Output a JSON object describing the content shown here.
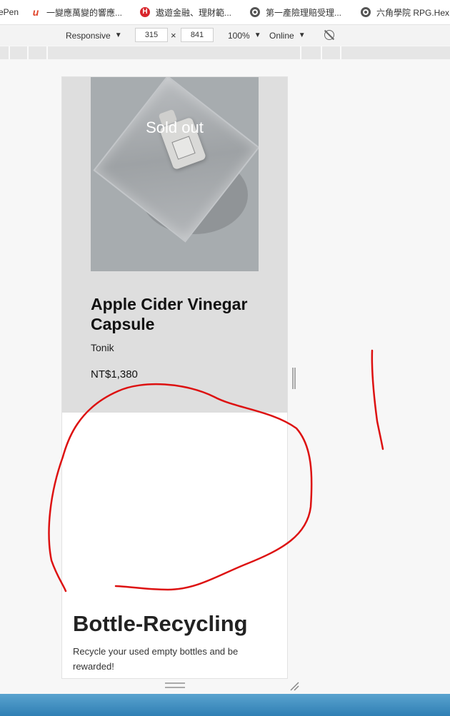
{
  "bookmarks": [
    {
      "label": "ePen",
      "icon": "codepen-icon"
    },
    {
      "label": "一變應萬變的響應...",
      "icon": "u-logo-icon"
    },
    {
      "label": "遨遊金融、理財範...",
      "icon": "h-logo-icon"
    },
    {
      "label": "第一產險理賠受理...",
      "icon": "globe-icon"
    },
    {
      "label": "六角學院 RPG.Hex...",
      "icon": "globe-icon"
    }
  ],
  "devtools": {
    "device": "Responsive",
    "width": "315",
    "times": "×",
    "height": "841",
    "zoom": "100%",
    "network": "Online"
  },
  "product": {
    "badge": "Sold out",
    "title": "Apple Cider Vinegar Capsule",
    "vendor": "Tonik",
    "price": "NT$1,380"
  },
  "section": {
    "title": "Bottle-Recycling",
    "description": "Recycle your used empty bottles and be rewarded!"
  },
  "colors": {
    "annotation": "#dd1111",
    "card_background": "#dedede",
    "taskbar": "#3b8cc2"
  }
}
